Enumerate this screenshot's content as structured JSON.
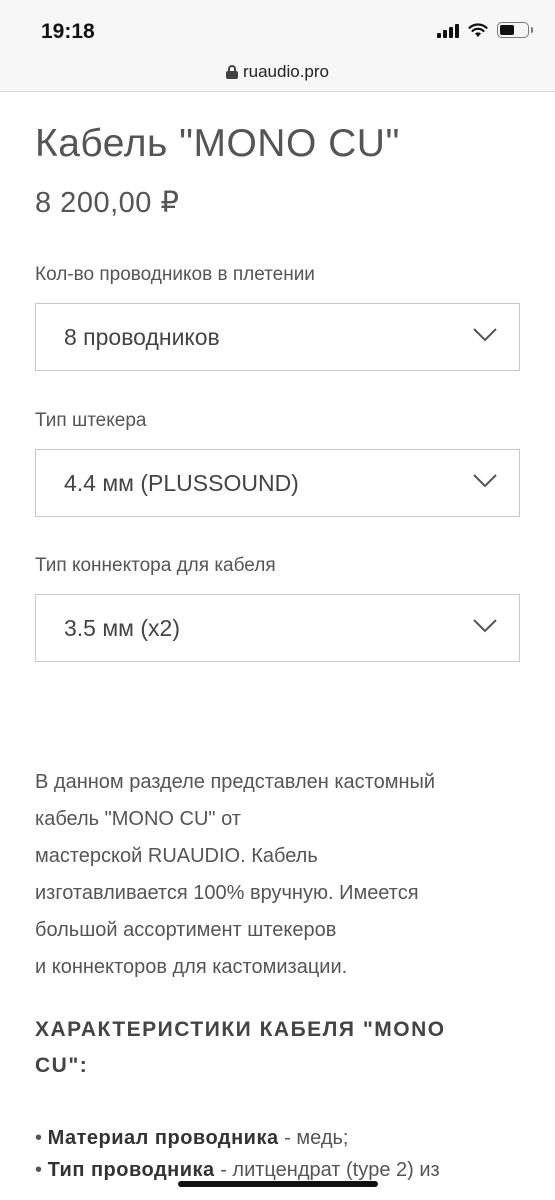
{
  "status_bar": {
    "time": "19:18"
  },
  "browser": {
    "url": "ruaudio.pro"
  },
  "product": {
    "title": "Кабель \"MONO CU\"",
    "price": "8 200,00 ₽"
  },
  "options": [
    {
      "label": "Кол-во проводников в плетении",
      "value": "8 проводников"
    },
    {
      "label": "Тип штекера",
      "value": "4.4 мм (PLUSSOUND)"
    },
    {
      "label": "Тип коннектора для кабеля",
      "value": "3.5 мм (x2)"
    }
  ],
  "description": {
    "lines": [
      "В данном разделе представлен кастомный",
      "кабель \"MONO CU\" от",
      "мастерской RUAUDIO. Кабель",
      "изготавливается 100% вручную. Имеется",
      "большой ассортимент штекеров",
      "и коннекторов для кастомизации."
    ]
  },
  "specs": {
    "heading_lines": [
      "ХАРАКТЕРИСТИКИ КАБЕЛЯ \"MONO",
      "CU\":"
    ],
    "items": [
      {
        "name": "Материал проводника",
        "value": " - медь;"
      },
      {
        "name": "Тип проводника",
        "value": " - литцендрат (type 2) из"
      }
    ]
  }
}
